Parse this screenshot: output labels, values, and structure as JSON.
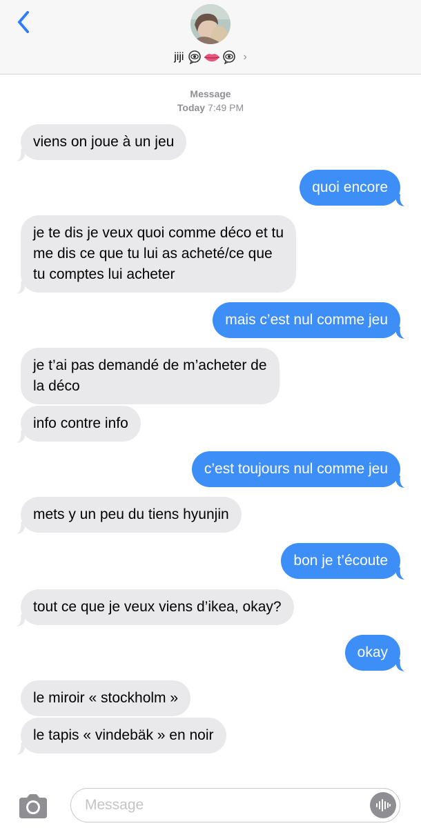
{
  "header": {
    "contact_name": "jiji",
    "back_icon": "chevron-left-icon",
    "emoji": [
      "eye-in-speech-bubble",
      "lips",
      "eye-in-speech-bubble"
    ],
    "chevron": "›"
  },
  "thread": {
    "service": "Message",
    "day": "Today",
    "time": "7:49 PM"
  },
  "messages": [
    {
      "dir": "in",
      "lines": [
        "viens on joue à un jeu"
      ]
    },
    {
      "dir": "out",
      "lines": [
        "quoi encore"
      ]
    },
    {
      "dir": "in",
      "lines": [
        "je te dis je veux quoi comme déco et tu",
        "me dis ce que tu lui as acheté/ce que",
        "tu comptes lui acheter"
      ]
    },
    {
      "dir": "out",
      "lines": [
        "mais c’est nul comme jeu"
      ]
    },
    {
      "dir": "in",
      "lines": [
        "je t’ai pas demandé de m’acheter de",
        "la déco"
      ]
    },
    {
      "dir": "in",
      "lines": [
        "info contre info"
      ]
    },
    {
      "dir": "out",
      "lines": [
        "c’est toujours nul comme jeu"
      ]
    },
    {
      "dir": "in",
      "lines": [
        "mets y un peu du tiens hyunjin"
      ]
    },
    {
      "dir": "out",
      "lines": [
        "bon je t’écoute"
      ]
    },
    {
      "dir": "in",
      "lines": [
        "tout ce que je veux viens d’ikea, okay?"
      ]
    },
    {
      "dir": "out",
      "lines": [
        "okay"
      ]
    },
    {
      "dir": "in",
      "lines": [
        "le miroir « stockholm »"
      ]
    },
    {
      "dir": "in",
      "lines": [
        "le tapis « vindebäk » en noir"
      ]
    }
  ],
  "composer": {
    "placeholder": "Message",
    "value": "",
    "camera_icon": "camera-icon",
    "audio_icon": "audio-waveform-icon"
  },
  "colors": {
    "outgoing": "#3d8ef6",
    "incoming": "#e9e9eb",
    "back_blue": "#2f7cf6",
    "meta_gray": "#8e8e93"
  }
}
